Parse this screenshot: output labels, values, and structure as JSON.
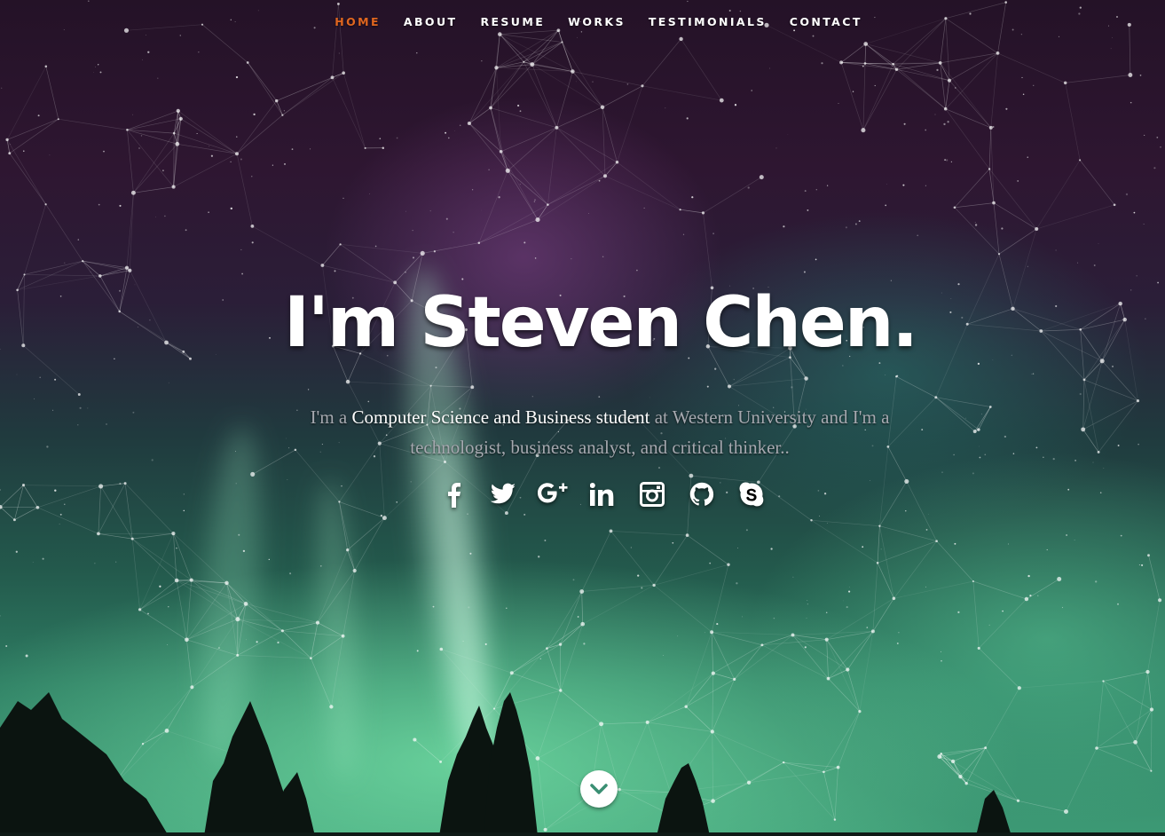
{
  "nav": {
    "items": [
      {
        "label": "HOME",
        "active": true
      },
      {
        "label": "ABOUT",
        "active": false
      },
      {
        "label": "RESUME",
        "active": false
      },
      {
        "label": "WORKS",
        "active": false
      },
      {
        "label": "TESTIMONIALS",
        "active": false
      },
      {
        "label": "CONTACT",
        "active": false
      }
    ],
    "active_color": "#e0661f"
  },
  "hero": {
    "headline": "I'm Steven Chen.",
    "intro_part1": "I'm a ",
    "intro_strong": "Computer Science and Business student",
    "intro_part2": " at Western University and I'm a technologist, business analyst, and critical thinker.."
  },
  "social": {
    "icons": [
      "facebook-icon",
      "twitter-icon",
      "google-plus-icon",
      "linkedin-icon",
      "instagram-icon",
      "github-icon",
      "skype-icon"
    ]
  },
  "scroll_down": {
    "icon": "chevron-down-icon"
  }
}
